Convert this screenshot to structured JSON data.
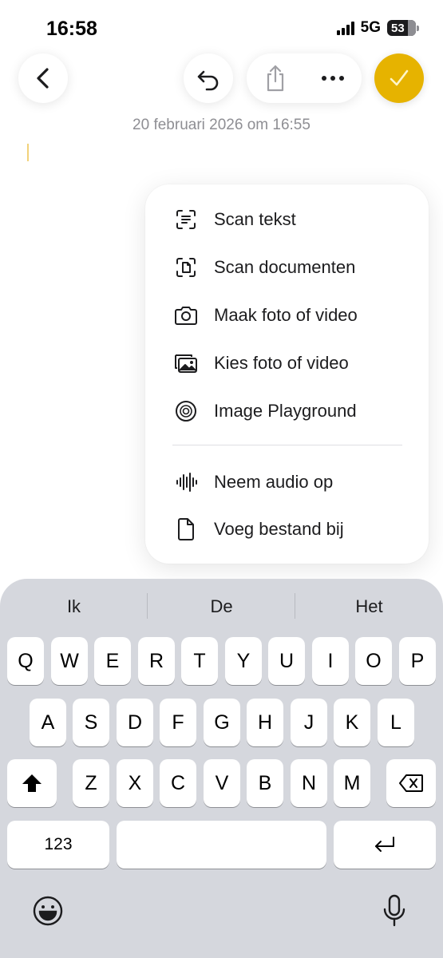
{
  "status_bar": {
    "time": "16:58",
    "network": "5G",
    "battery": "53"
  },
  "toolbar": {
    "back_icon": "chevron-left-icon",
    "undo_icon": "undo-icon",
    "share_icon": "share-icon",
    "more_icon": "ellipsis-icon",
    "done_icon": "checkmark-icon",
    "accent_color": "#e6b300"
  },
  "note": {
    "date": "20 februari 2026 om 16:55"
  },
  "attach_menu": {
    "items": [
      {
        "label": "Scan tekst",
        "icon": "scan-text-icon"
      },
      {
        "label": "Scan documenten",
        "icon": "scan-document-icon"
      },
      {
        "label": "Maak foto of video",
        "icon": "camera-icon"
      },
      {
        "label": "Kies foto of video",
        "icon": "photo-library-icon"
      },
      {
        "label": "Image Playground",
        "icon": "image-playground-icon"
      },
      {
        "label": "Neem audio op",
        "icon": "waveform-icon"
      },
      {
        "label": "Voeg bestand bij",
        "icon": "document-icon"
      }
    ]
  },
  "keyboard": {
    "suggestions": [
      "Ik",
      "De",
      "Het"
    ],
    "row1": [
      "Q",
      "W",
      "E",
      "R",
      "T",
      "Y",
      "U",
      "I",
      "O",
      "P"
    ],
    "row2": [
      "A",
      "S",
      "D",
      "F",
      "G",
      "H",
      "J",
      "K",
      "L"
    ],
    "row3": [
      "Z",
      "X",
      "C",
      "V",
      "B",
      "N",
      "M"
    ],
    "numbers_label": "123",
    "shift_icon": "shift-icon",
    "delete_icon": "backspace-icon",
    "return_icon": "return-icon",
    "emoji_icon": "emoji-icon",
    "mic_icon": "microphone-icon"
  }
}
